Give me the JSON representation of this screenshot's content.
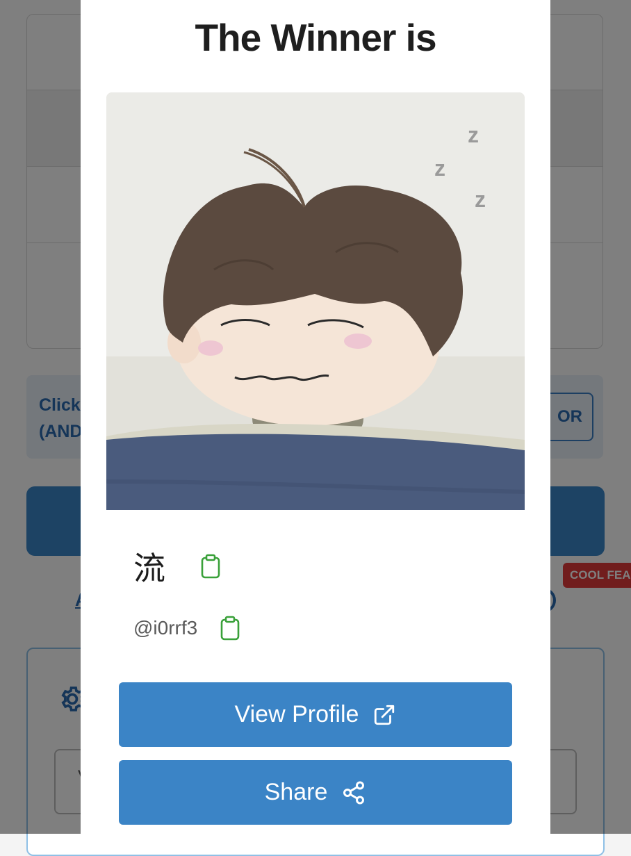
{
  "background": {
    "notice_text": "Click\n(AND",
    "or_button_label": "OR",
    "link_text": "A",
    "badge_text": "COOL FEA",
    "input_label": "V"
  },
  "modal": {
    "title": "The Winner is",
    "winner": {
      "name": "流",
      "handle": "@i0rrf3"
    },
    "buttons": {
      "view_profile": "View Profile",
      "share": "Share"
    }
  },
  "icons": {
    "clipboard": "clipboard-icon",
    "external_link": "external-link-icon",
    "share": "share-icon",
    "gear": "gear-icon"
  },
  "colors": {
    "primary": "#3b84c6",
    "clipboard_green": "#3aa13a",
    "badge_red": "#e33a3a"
  }
}
